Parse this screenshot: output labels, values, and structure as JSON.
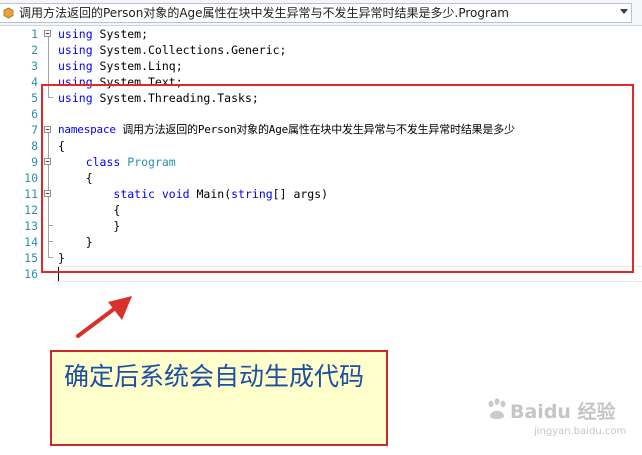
{
  "navigation_bar": {
    "class_selector": "调用方法返回的Person对象的Age属性在块中发生异常与不发生异常时结果是多少.Program"
  },
  "editor": {
    "line_numbers": [
      "1",
      "2",
      "3",
      "4",
      "5",
      "6",
      "7",
      "8",
      "9",
      "10",
      "11",
      "12",
      "13",
      "14",
      "15",
      "16"
    ],
    "lines": {
      "l1_kw": "using",
      "l1_rest": " System;",
      "l2_kw": "using",
      "l2_rest": " System.Collections.Generic;",
      "l3_kw": "using",
      "l3_rest": " System.Linq;",
      "l4_kw": "using",
      "l4_rest": " System.Text;",
      "l5_kw": "using",
      "l5_rest": " System.Threading.Tasks;",
      "l7_kw": "namespace",
      "l7_rest": " 调用方法返回的Person对象的Age属性在块中发生异常与不发生异常时结果是多少",
      "l8": "{",
      "l9_indent": "    ",
      "l9_kw": "class",
      "l9_sp": " ",
      "l9_type": "Program",
      "l10": "    {",
      "l11_indent": "        ",
      "l11_kw1": "static",
      "l11_sp1": " ",
      "l11_kw2": "void",
      "l11_mid": " Main(",
      "l11_kw3": "string",
      "l11_end": "[] args)",
      "l12": "        {",
      "l13": "        }",
      "l14": "    }",
      "l15": "}"
    }
  },
  "annotation": {
    "text": "确定后系统会自动生成代码"
  },
  "watermark": {
    "brand": "Baidu 经验",
    "url": "jingyan.baidu.com"
  },
  "colors": {
    "keyword": "#0000ff",
    "type_name": "#2b91af",
    "line_number": "#2b91af",
    "highlight_box": "#e02a2a",
    "note_background": "#ffffcc",
    "note_text": "#1c4fa3"
  }
}
